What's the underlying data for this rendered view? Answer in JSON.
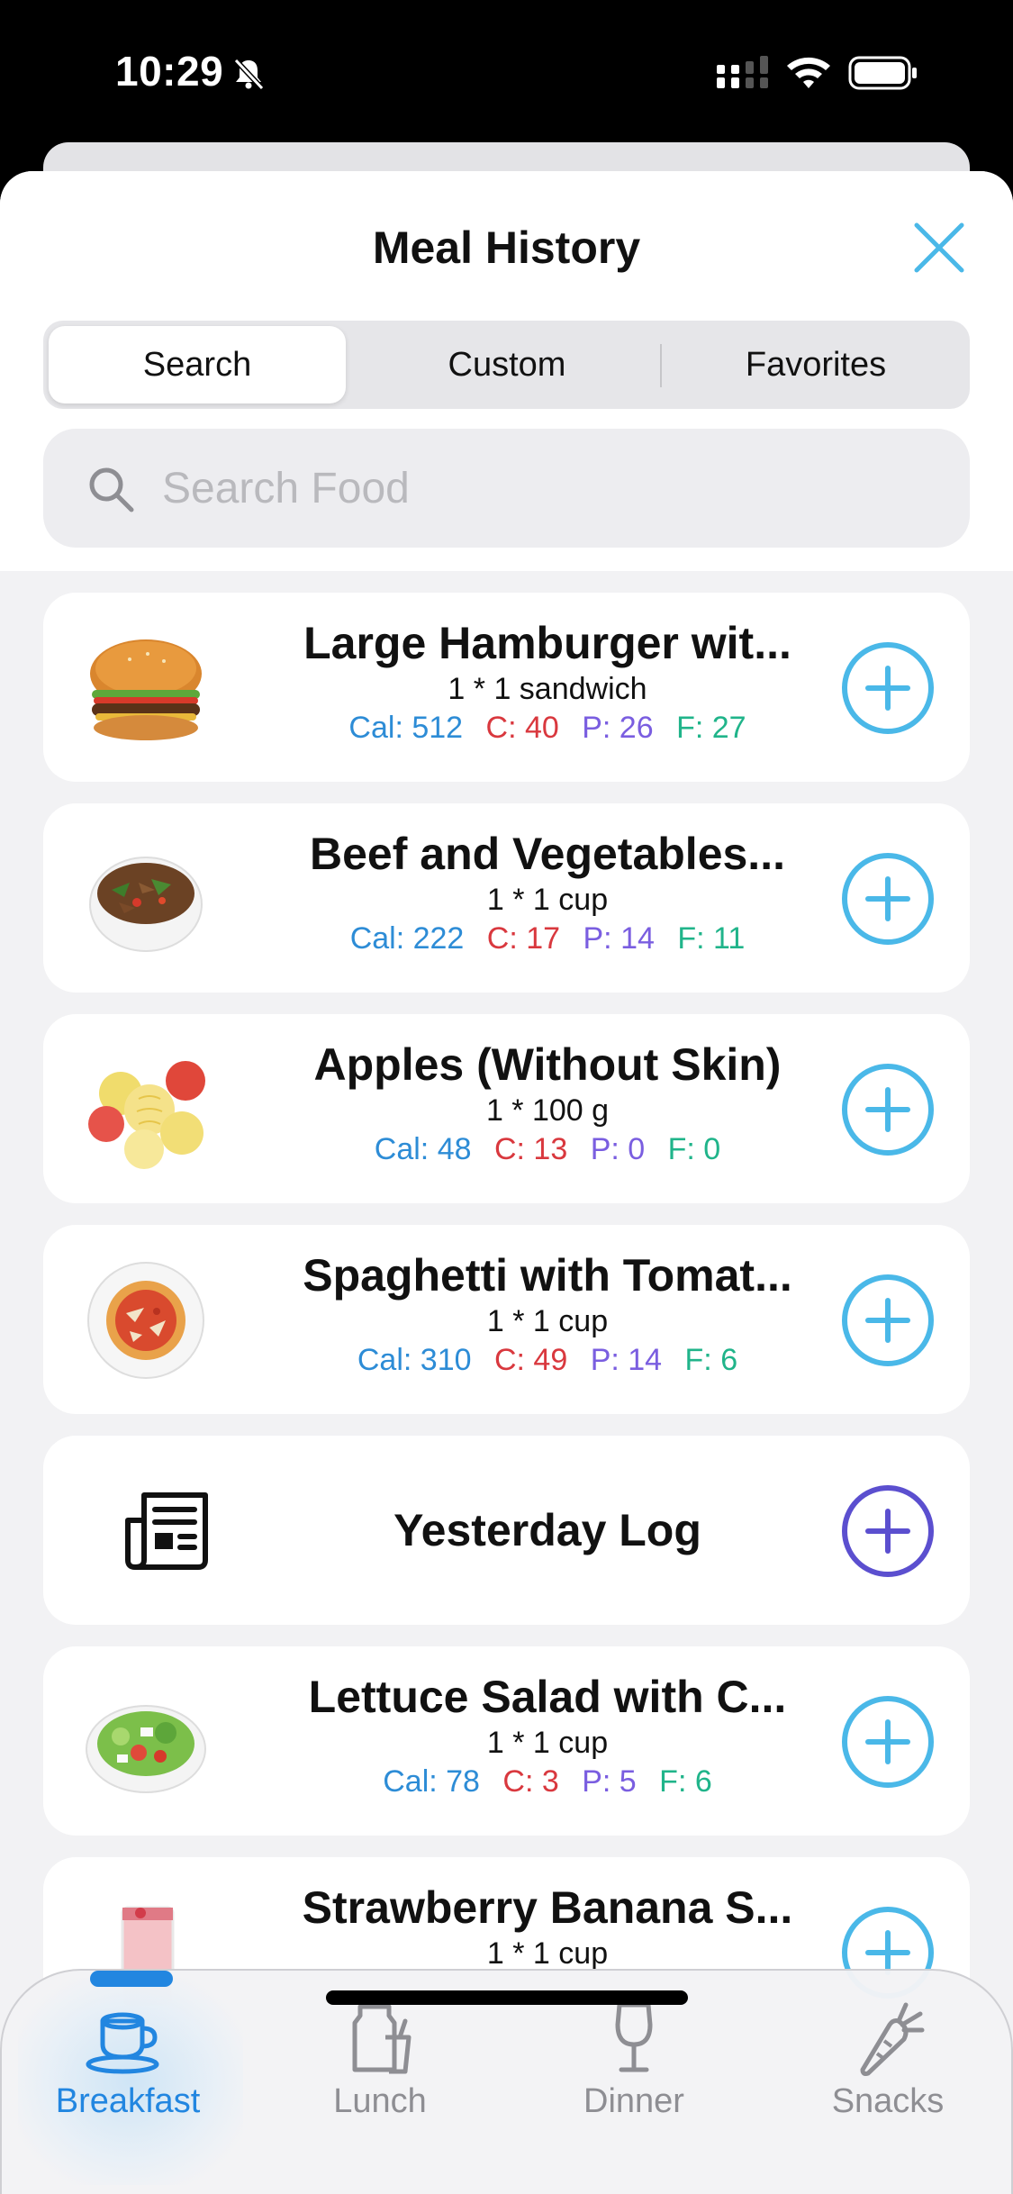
{
  "status_bar": {
    "time": "10:29"
  },
  "header": {
    "title": "Meal History"
  },
  "segments": [
    {
      "label": "Search",
      "active": true
    },
    {
      "label": "Custom",
      "active": false
    },
    {
      "label": "Favorites",
      "active": false
    }
  ],
  "search": {
    "placeholder": "Search Food",
    "value": ""
  },
  "items": [
    {
      "name": "Large Hamburger wit...",
      "serving": "1 * 1 sandwich",
      "cal": "Cal: 512",
      "carb": "C: 40",
      "prot": "P: 26",
      "fat": "F: 27",
      "image": "hamburger"
    },
    {
      "name": "Beef and Vegetables...",
      "serving": "1 * 1 cup",
      "cal": "Cal: 222",
      "carb": "C: 17",
      "prot": "P: 14",
      "fat": "F: 11",
      "image": "beef-vegetables-bowl"
    },
    {
      "name": "Apples (Without Skin)",
      "serving": "1 * 100 g",
      "cal": "Cal: 48",
      "carb": "C: 13",
      "prot": "P: 0",
      "fat": "F: 0",
      "image": "peeled-apples"
    },
    {
      "name": "Spaghetti with Tomat...",
      "serving": "1 * 1 cup",
      "cal": "Cal: 310",
      "carb": "C: 49",
      "prot": "P: 14",
      "fat": "F: 6",
      "image": "spaghetti-plate"
    },
    {
      "name": "Lettuce Salad with C...",
      "serving": "1 * 1 cup",
      "cal": "Cal: 78",
      "carb": "C: 3",
      "prot": "P: 5",
      "fat": "F: 6",
      "image": "lettuce-salad"
    },
    {
      "name": "Strawberry Banana S...",
      "serving": "1 * 1 cup",
      "image": "strawberry-smoothie"
    }
  ],
  "yesterday_log": {
    "label": "Yesterday Log",
    "icon": "newspaper-icon"
  },
  "tabs": [
    {
      "label": "Breakfast",
      "icon": "cup-icon",
      "active": true
    },
    {
      "label": "Lunch",
      "icon": "lunch-icon",
      "active": false
    },
    {
      "label": "Dinner",
      "icon": "wine-glass-icon",
      "active": false
    },
    {
      "label": "Snacks",
      "icon": "carrot-icon",
      "active": false
    }
  ],
  "colors": {
    "accent": "#4ab8e8",
    "cal": "#2d8cd6",
    "carb": "#d9383e",
    "prot": "#7a5ee0",
    "fat": "#20b48a",
    "log_button": "#5b4fcf",
    "tab_active": "#2286e0",
    "tab_inactive": "#8e8e93"
  }
}
